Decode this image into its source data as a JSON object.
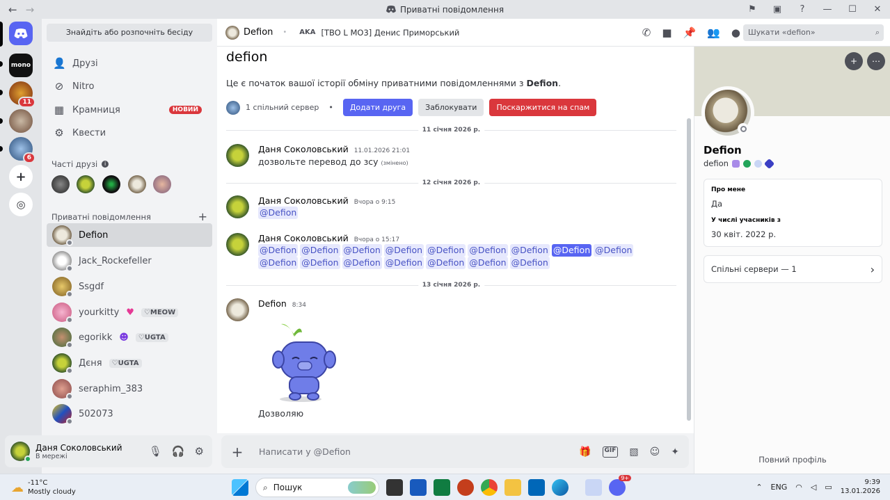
{
  "window": {
    "title": "Приватні повідомлення",
    "back": "←",
    "fwd": "→"
  },
  "sidebar": {
    "search_label": "Знайдіть або розпочніть бесіду",
    "nav": [
      {
        "label": "Друзі",
        "icon": "friends-icon"
      },
      {
        "label": "Nitro",
        "icon": "nitro-icon"
      },
      {
        "label": "Крамниця",
        "icon": "shop-icon",
        "badge": "НОВИЙ"
      },
      {
        "label": "Квести",
        "icon": "quests-icon"
      }
    ],
    "frequent_title": "Часті друзі",
    "dm_title": "Приватні повідомлення",
    "dms": [
      {
        "name": "Defion",
        "tag": ""
      },
      {
        "name": "Jack_Rockefeller",
        "tag": ""
      },
      {
        "name": "Ssgdf",
        "tag": ""
      },
      {
        "name": "yourkitty",
        "tag": "MEOW"
      },
      {
        "name": "egorikk",
        "tag": "UGTA"
      },
      {
        "name": "Дєня",
        "tag": "UGTA"
      },
      {
        "name": "seraphim_383",
        "tag": ""
      },
      {
        "name": "502073",
        "tag": ""
      }
    ]
  },
  "servers": {
    "mono_label": "mono",
    "badges": [
      "11",
      "6"
    ]
  },
  "user": {
    "name": "Даня Соколовський",
    "status": "В мережі"
  },
  "header": {
    "name": "Defion",
    "aka": "AKA",
    "aka_value": "[TBO L MO3] Денис Приморський",
    "search_placeholder": "Шукати «defion»"
  },
  "chat": {
    "title": "defion",
    "intro": "Це є початок вашої історії обміну приватними повідомленнями з",
    "intro_name": "Defion",
    "mutual": "1 спільний сервер",
    "add_friend": "Додати друга",
    "block": "Заблокувати",
    "report": "Поскаржитися на спам",
    "dates": [
      "11 січня 2026 р.",
      "12 січня 2026 р.",
      "13 січня 2026 р."
    ],
    "messages": [
      {
        "author": "Даня Соколовський",
        "time": "11.01.2026 21:01",
        "text": "дозвольте перевод до зсу",
        "edited": "(змінено)"
      },
      {
        "author": "Даня Соколовський",
        "time": "Вчора о 9:15",
        "mention": "@Defion"
      },
      {
        "author": "Даня Соколовський",
        "time": "Вчора о 15:17",
        "mention": "@Defion",
        "count": 16
      },
      {
        "author": "Defion",
        "time": "8:34",
        "text": "Дозволяю"
      }
    ]
  },
  "composer": {
    "placeholder": "Написати у @Defion"
  },
  "profile": {
    "name": "Defion",
    "username": "defion",
    "about_label": "Про мене",
    "about": "Да",
    "member_label": "У числі учасників з",
    "member_since": "30 квіт. 2022 р.",
    "mutual_servers": "Спільні сервери — 1",
    "full_profile": "Повний профіль"
  },
  "taskbar": {
    "temp": "-11°C",
    "weather": "Mostly cloudy",
    "search": "Пошук",
    "lang": "ENG",
    "time": "9:39",
    "date": "13.01.2026",
    "discord_badge": "9+"
  },
  "colors": {
    "blurple": "#5865f2",
    "danger": "#da373c"
  }
}
